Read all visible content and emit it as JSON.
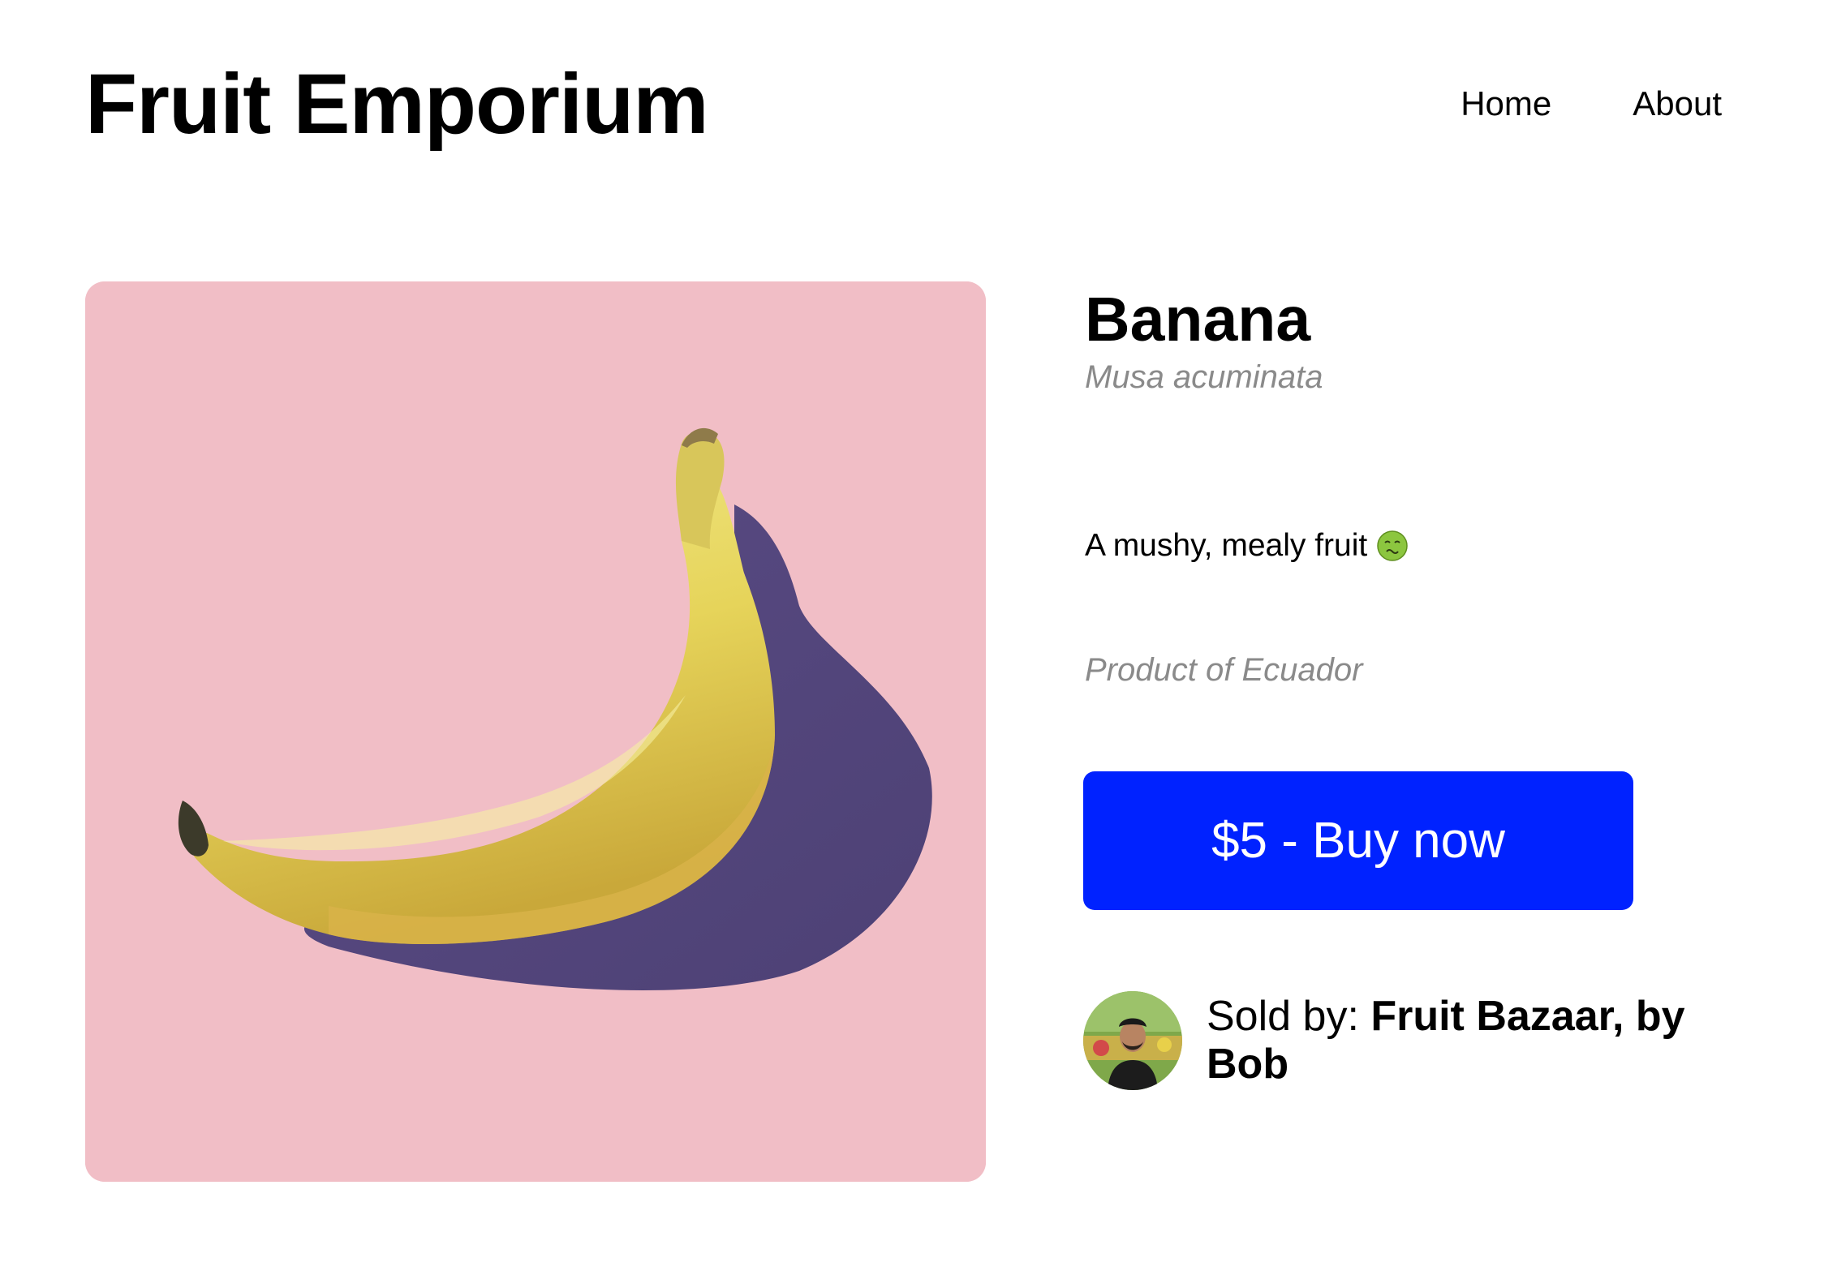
{
  "header": {
    "site_title": "Fruit Emporium",
    "nav": [
      {
        "label": "Home"
      },
      {
        "label": "About"
      }
    ]
  },
  "product": {
    "name": "Banana",
    "latin_name": "Musa acuminata",
    "description": "A mushy, mealy fruit",
    "description_icon": "nauseated-face-emoji-icon",
    "origin": "Product of Ecuador",
    "buy_button_label": "$5 - Buy now",
    "image": {
      "subject": "banana-photo",
      "background_color": "#f1bec6"
    }
  },
  "seller": {
    "prefix": "Sold by: ",
    "name": "Fruit Bazaar, by Bob",
    "avatar_icon": "seller-avatar"
  },
  "colors": {
    "accent": "#0022ff",
    "muted_text": "#8a8a8a",
    "image_background": "#f1bec6"
  }
}
